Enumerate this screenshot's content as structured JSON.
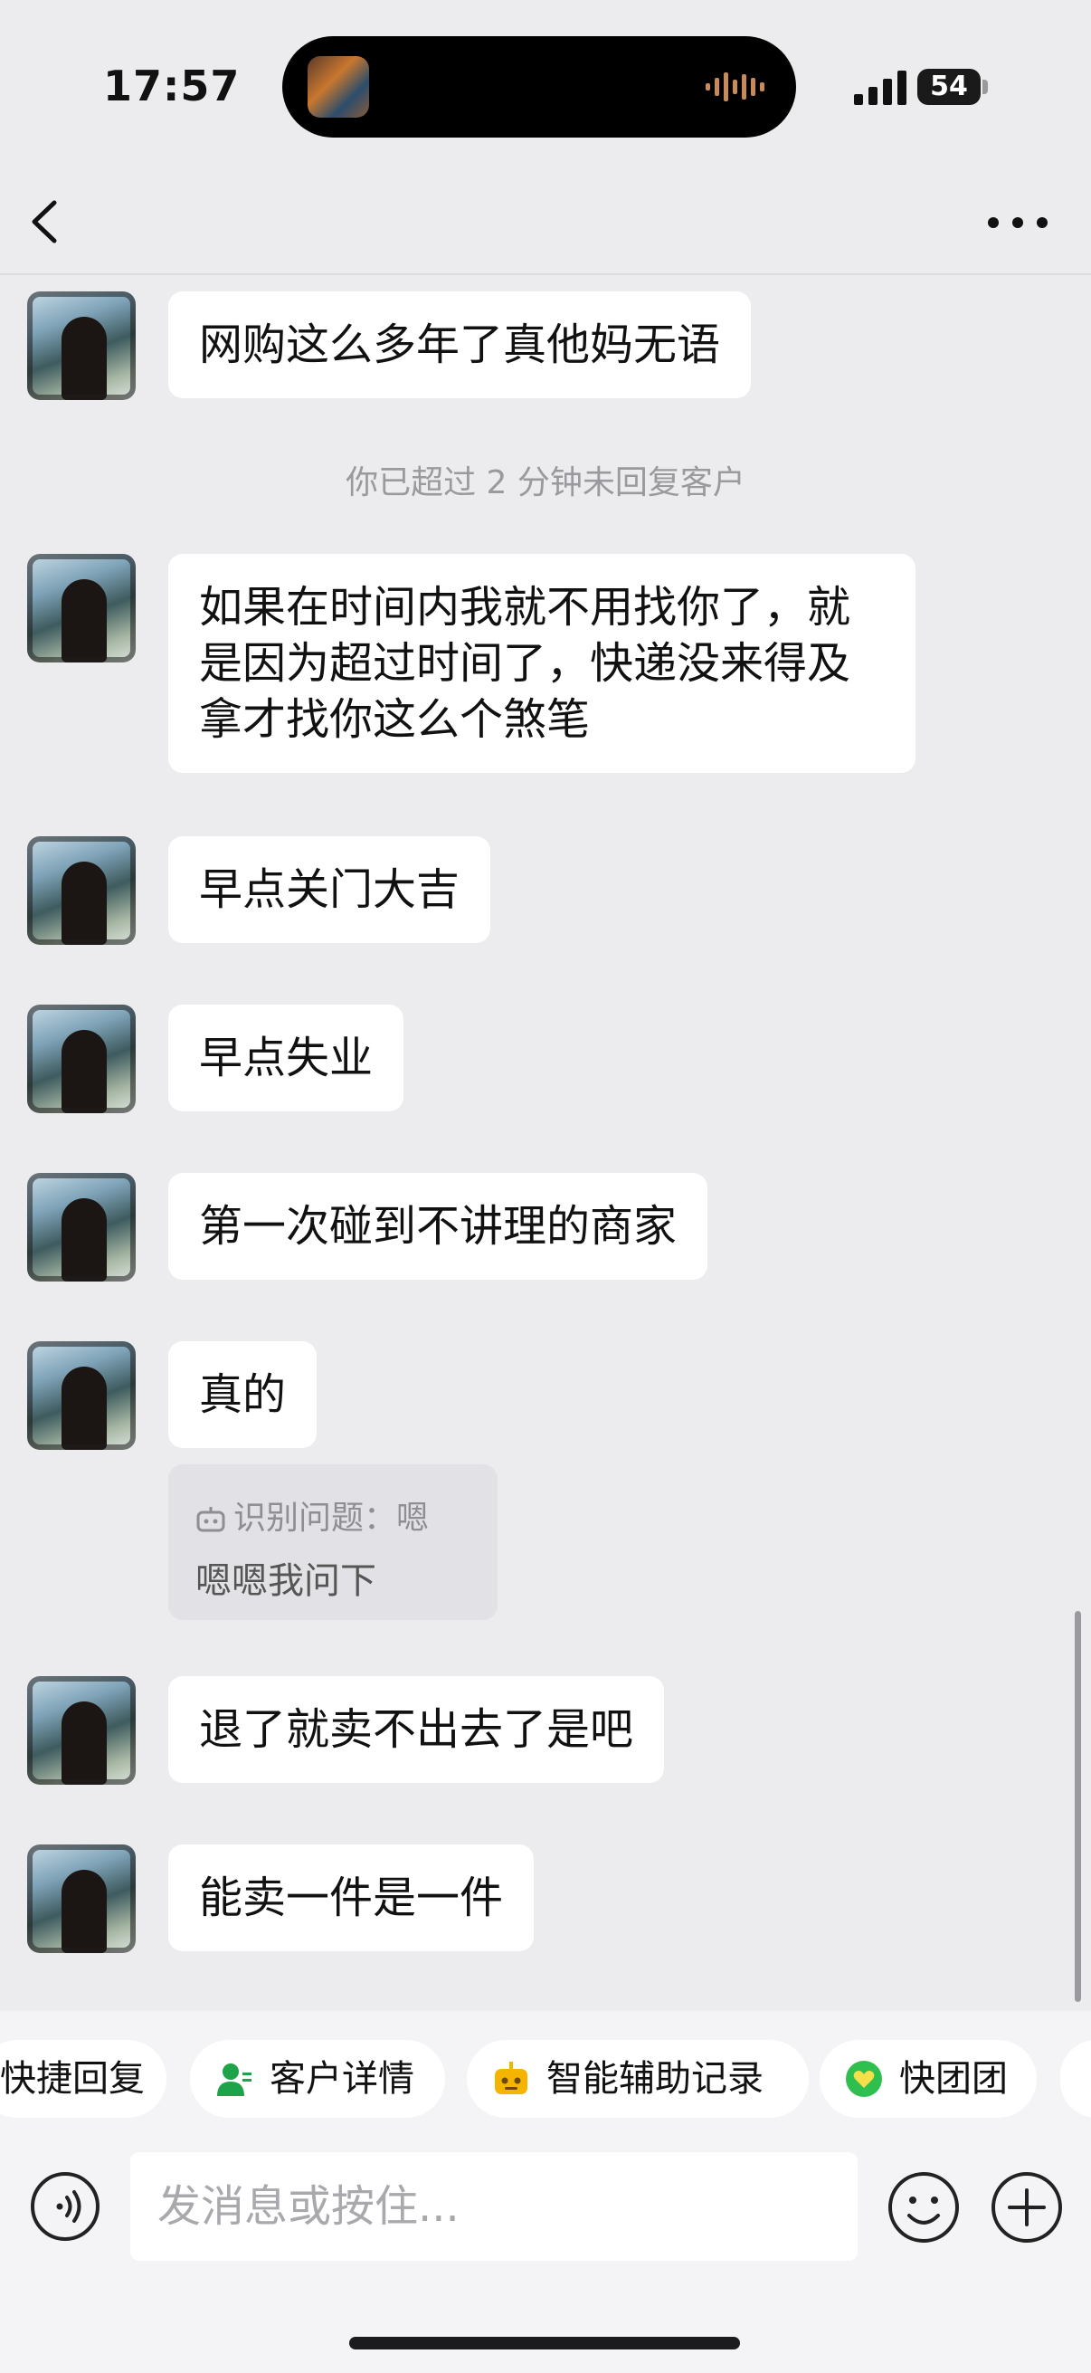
{
  "status_bar": {
    "time": "17:57",
    "battery": "54"
  },
  "header": {
    "back_icon": "chevron-left-icon",
    "more_icon": "ellipsis-icon"
  },
  "messages": [
    {
      "text": "网购这么多年了真他妈无语"
    },
    {
      "text": "如果在时间内我就不用找你了，就是因为超过时间了，快递没来得及拿才找你这么个煞笔"
    },
    {
      "text": "早点关门大吉"
    },
    {
      "text": "早点失业"
    },
    {
      "text": "第一次碰到不讲理的商家"
    },
    {
      "text": "真的"
    },
    {
      "text": "退了就卖不出去了是吧"
    },
    {
      "text": "能卖一件是一件"
    }
  ],
  "system_note": "你已超过 2 分钟未回复客户",
  "ai_assist": {
    "question": "识别问题：嗯",
    "suggestion": "嗯嗯我问下"
  },
  "quick_actions": [
    {
      "label": "快捷回复"
    },
    {
      "label": "客户详情",
      "icon": "user-detail-icon",
      "color": "#1fa34a"
    },
    {
      "label": "智能辅助记录",
      "icon": "robot-icon",
      "color": "#f5b400"
    },
    {
      "label": "快团团",
      "icon": "heart-icon",
      "color": "#2fbf4f"
    }
  ],
  "input": {
    "placeholder": "发消息或按住..."
  }
}
